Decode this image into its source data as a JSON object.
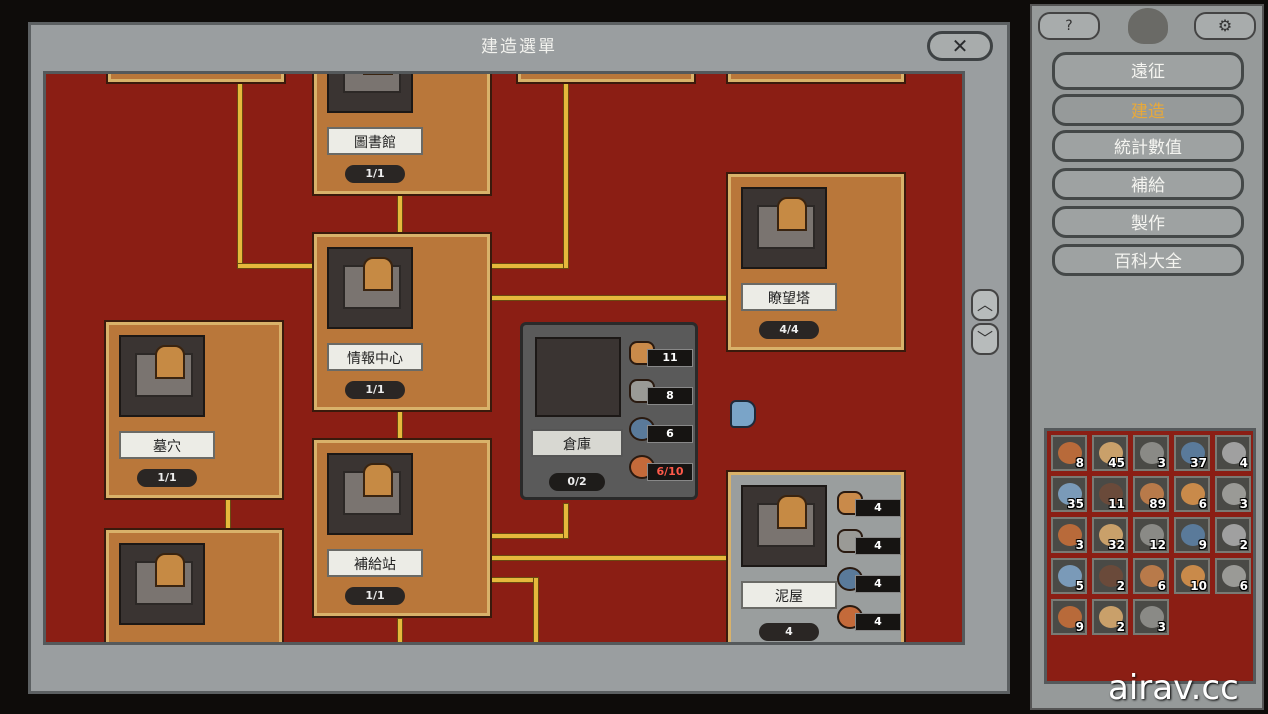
{
  "window": {
    "title": "建造選單",
    "close_glyph": "✕"
  },
  "scroll": {
    "up": "︿",
    "down": "﹀"
  },
  "buildings": [
    {
      "name": "圖書館",
      "count": "1/1"
    },
    {
      "name": "情報中心",
      "count": "1/1"
    },
    {
      "name": "墓穴",
      "count": "1/1"
    },
    {
      "name": "補給站",
      "count": "1/1"
    },
    {
      "name": "瞭望塔",
      "count": "4/4"
    },
    {
      "name": "倉庫",
      "count": "0/2"
    },
    {
      "name": "泥屋",
      "count": "4"
    }
  ],
  "storage_costs": [
    {
      "icon": "wood-icon",
      "value": "11"
    },
    {
      "icon": "stone-icon",
      "value": "8"
    },
    {
      "icon": "metal-icon",
      "value": "6"
    },
    {
      "icon": "food-icon",
      "value": "6/10"
    }
  ],
  "hut_costs": [
    {
      "icon": "wood-icon",
      "value": "4"
    },
    {
      "icon": "stone-icon",
      "value": "4"
    },
    {
      "icon": "metal-icon",
      "value": "4"
    },
    {
      "icon": "food-icon",
      "value": "4"
    }
  ],
  "menu": {
    "top_left": "?",
    "top_right": "⚙",
    "items": [
      {
        "label": "遠征",
        "active": false
      },
      {
        "label": "建造",
        "active": true
      },
      {
        "label": "統計數值",
        "active": false
      },
      {
        "label": "補給",
        "active": false
      },
      {
        "label": "製作",
        "active": false
      },
      {
        "label": "百科大全",
        "active": false
      }
    ],
    "active_color": "#e8a93a"
  },
  "inventory": [
    "8",
    "45",
    "3",
    "37",
    "4",
    "35",
    "11",
    "89",
    "6",
    "3",
    "3",
    "32",
    "12",
    "9",
    "2",
    "5",
    "2",
    "6",
    "10",
    "6",
    "9",
    "2",
    "3"
  ],
  "watermark": "airav.cc"
}
